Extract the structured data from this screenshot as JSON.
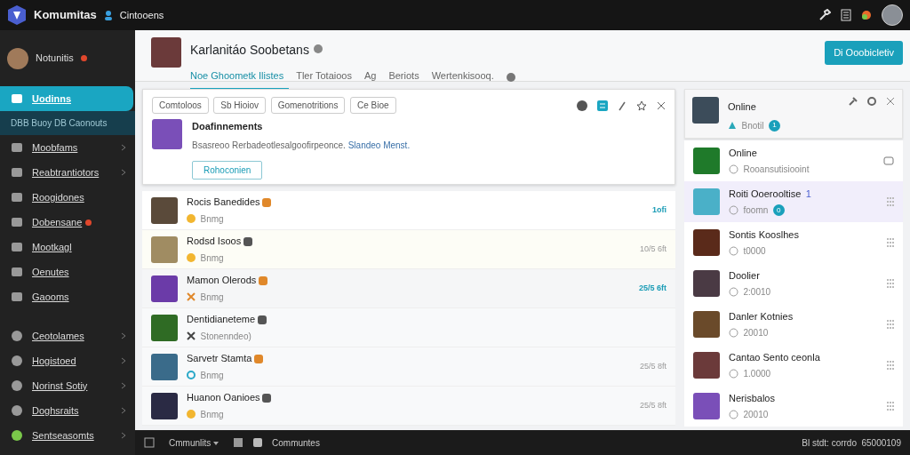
{
  "topbar": {
    "brand": "Komumitas",
    "location": "Cintooens"
  },
  "sidebar": {
    "user": {
      "name": "Notunitis",
      "alert": true
    },
    "items": [
      {
        "label": "Uodinns",
        "selected": true,
        "sublabel": "DBB Buoy DB Caonouts",
        "chevron": false,
        "alert": false
      },
      {
        "label": "Moobfams",
        "selected": false,
        "chevron": true,
        "alert": false
      },
      {
        "label": "Reabtrantiotors",
        "selected": false,
        "chevron": true,
        "alert": false
      },
      {
        "label": "Roogidones",
        "selected": false,
        "chevron": false,
        "alert": false
      },
      {
        "label": "Dobensane",
        "selected": false,
        "chevron": false,
        "alert": true
      },
      {
        "label": "Mootkagl",
        "selected": false,
        "chevron": false,
        "alert": false
      },
      {
        "label": "Oenutes",
        "selected": false,
        "chevron": false,
        "alert": false
      },
      {
        "label": "Gaooms",
        "selected": false,
        "chevron": false,
        "alert": false
      }
    ],
    "groups": [
      {
        "label": "Ceotolames",
        "chevron": true
      },
      {
        "label": "Hogistoed",
        "chevron": true
      },
      {
        "label": "Norinst Sotiy",
        "chevron": true
      },
      {
        "label": "Doghsraits",
        "chevron": true
      },
      {
        "label": "Sentseasomts",
        "chevron": true
      }
    ]
  },
  "header": {
    "title": "Karlanitáo Soobetans",
    "button": "Di Ooobicletiv",
    "tabs": [
      {
        "label": "Noe Ghoometk Ilistes",
        "selected": true
      },
      {
        "label": "Tler Totaioos",
        "selected": false
      },
      {
        "label": "Ag",
        "selected": false
      },
      {
        "label": "Beriots",
        "selected": false
      },
      {
        "label": "Wertenkisooq.",
        "selected": false
      }
    ]
  },
  "notice": {
    "chips": [
      "Comtoloos",
      "Sb Hioiov",
      "Gomenotritions",
      "Ce Bioe"
    ],
    "title": "Doafinnements",
    "text": "Bsasreoo Rerbadeotlesalgoofirpeonce.",
    "link": "Slandeo Menst.",
    "button": "Rohoconien"
  },
  "feed": [
    {
      "title": "Rocis Banedides",
      "subtitle": "Bnmg",
      "time": "1ofi",
      "unread": true,
      "kind": "smile"
    },
    {
      "title": "Rodsd Isoos",
      "subtitle": "Bnmg",
      "time": "10/5 6ft",
      "unread": false,
      "kind": "smile"
    },
    {
      "title": "Mamon Olerods",
      "subtitle": "Bnmg",
      "time": "25/5 6ft",
      "unread": true,
      "kind": "cross"
    },
    {
      "title": "Dentidianeteme",
      "subtitle": "Stonenndeo)",
      "kind": "tool"
    },
    {
      "title": "Sarvetr Stamta",
      "subtitle": "Bnmg",
      "time": "25/5 8ft",
      "unread": false,
      "kind": "ring"
    },
    {
      "title": "Huanon Oanioes",
      "subtitle": "Bnmg",
      "time": "25/5 8ft",
      "unread": false,
      "kind": "smile"
    }
  ],
  "panel": {
    "name": "Online",
    "status": "Bnotil",
    "count": "1",
    "rows": [
      {
        "name": "Online",
        "status": "Rooansutisiooint",
        "selected": false,
        "kind": "chat"
      },
      {
        "name": "Roiti Ooerooltise",
        "number": "1",
        "status": "foomn",
        "count": "0",
        "selected": true,
        "kind": "grip"
      },
      {
        "name": "Sontis Kooslhes",
        "status": "t0000",
        "selected": false,
        "kind": "grip"
      },
      {
        "name": "Doolier",
        "status": "2:0010",
        "selected": false,
        "kind": "grip"
      },
      {
        "name": "Danler Kotnies",
        "status": "20010",
        "selected": false,
        "kind": "grip"
      },
      {
        "name": "Cantao Sento ceonla",
        "status": "1.0000",
        "selected": false,
        "kind": "grip"
      },
      {
        "name": "Nerisbalos",
        "status": "20010",
        "selected": false,
        "kind": "grip"
      }
    ]
  },
  "bottombar": {
    "menu": "Cmmunlits",
    "tab": "Communtes",
    "status": "Bl stdt: corrdo",
    "code": "65000109"
  }
}
